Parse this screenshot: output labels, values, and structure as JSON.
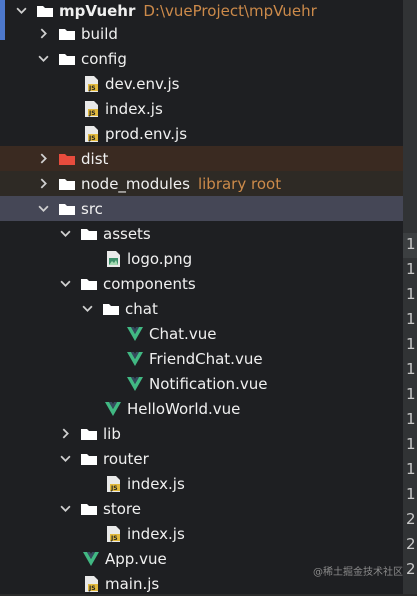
{
  "project": {
    "name": "mpVuehr",
    "path": "D:\\vueProject\\mpVuehr"
  },
  "tree": {
    "build": "build",
    "config": "config",
    "dev_env": "dev.env.js",
    "index_js": "index.js",
    "prod_env": "prod.env.js",
    "dist": "dist",
    "node_modules": "node_modules",
    "library_root": "library root",
    "src": "src",
    "assets": "assets",
    "logo": "logo.png",
    "components": "components",
    "chat": "chat",
    "chat_vue": "Chat.vue",
    "friendchat_vue": "FriendChat.vue",
    "notification_vue": "Notification.vue",
    "helloworld_vue": "HelloWorld.vue",
    "lib": "lib",
    "router": "router",
    "router_index": "index.js",
    "store": "store",
    "store_index": "index.js",
    "app_vue": "App.vue",
    "main_js": "main.js"
  },
  "gutter_digits": [
    "1",
    "1",
    "1",
    "1",
    "1",
    "1",
    "1",
    "1",
    "1",
    "1",
    "1",
    "2",
    "2",
    "2"
  ],
  "watermark": "@稀土掘金技术社区",
  "colors": {
    "background": "#1e1f22",
    "src_selected": "#454756",
    "dist_row": "#3a2a21",
    "library_root_hint": "#cc8a4a",
    "vue_green": "#41b883",
    "folder": "#ffffff",
    "dist_folder": "#e84c3d",
    "js_yellow": "#e2b93d"
  }
}
